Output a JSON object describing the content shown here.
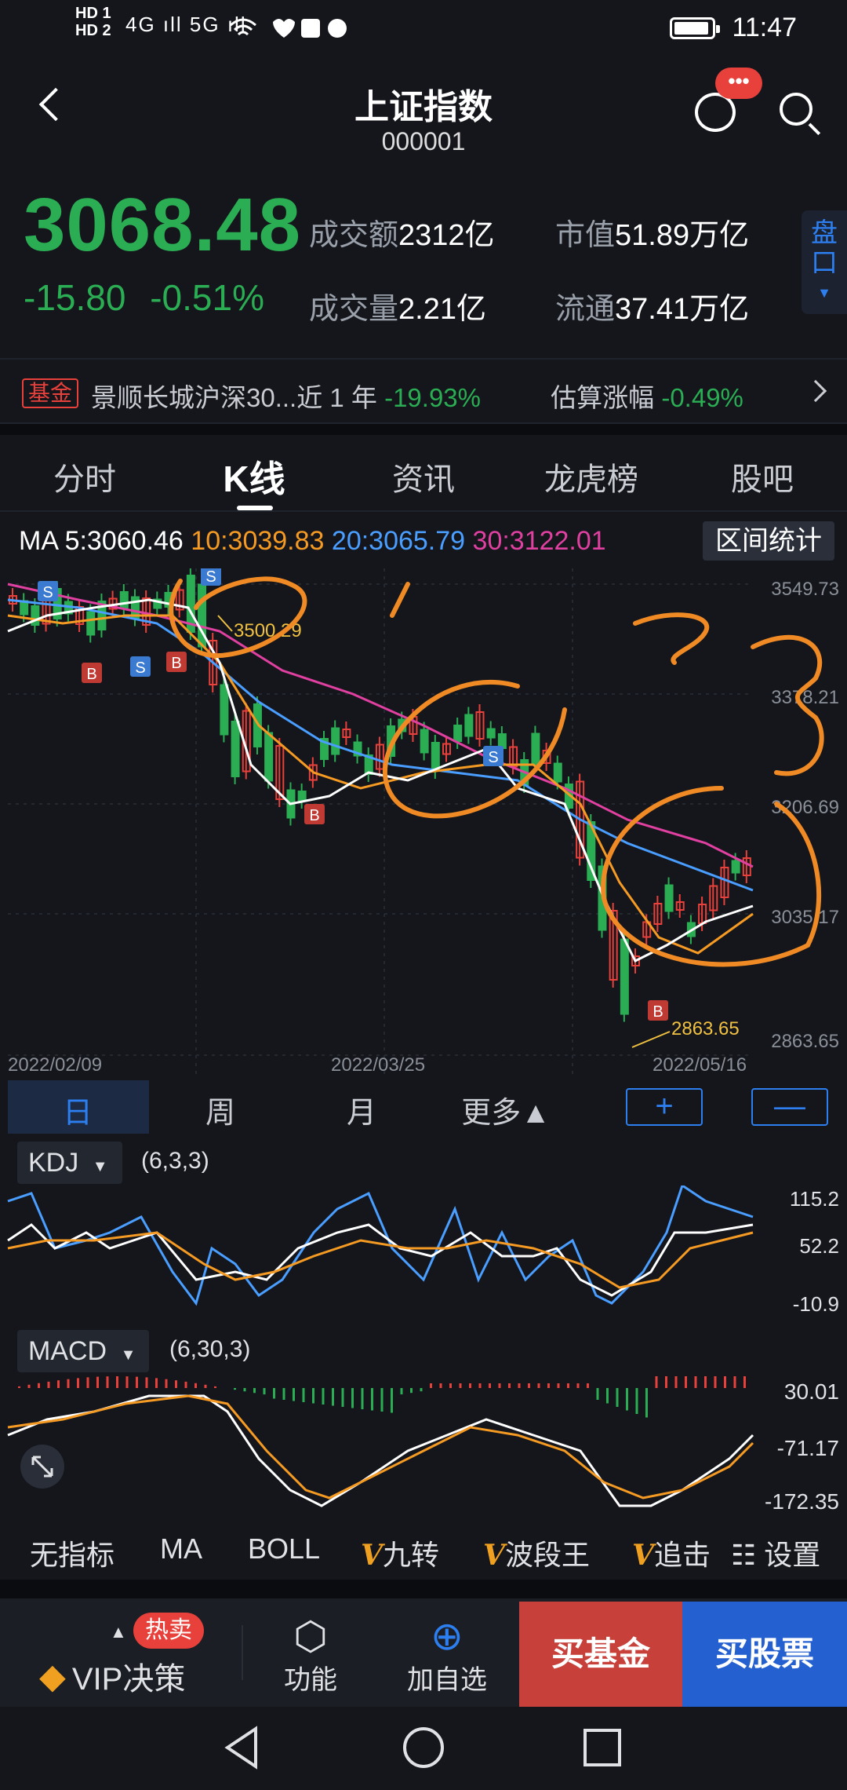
{
  "status_bar": {
    "hd1": "HD 1",
    "hd2": "HD 2",
    "signal": "4G ıll 5G ıll",
    "time": "11:47"
  },
  "header": {
    "title": "上证指数",
    "code": "000001",
    "chat_badge": "•••"
  },
  "quote": {
    "price": "3068.48",
    "change": "-15.80",
    "change_pct": "-0.51%",
    "turnover_label": "成交额",
    "turnover_value": "2312亿",
    "volume_label": "成交量",
    "volume_value": "2.21亿",
    "mktcap_label": "市值",
    "mktcap_value": "51.89万亿",
    "float_label": "流通",
    "float_value": "37.41万亿",
    "pankou": "盘口"
  },
  "fund": {
    "tag": "基金",
    "name": "景顺长城沪深30...近 1 年",
    "year_return": "-19.93%",
    "est_label": "估算涨幅",
    "est_value": "-0.49%"
  },
  "tabs": [
    "分时",
    "K线",
    "资讯",
    "龙虎榜",
    "股吧"
  ],
  "ma": {
    "ma5": "MA 5:3060.46",
    "ma10": "10:3039.83",
    "ma20": "20:3065.79",
    "ma30": "30:3122.01",
    "range_button": "区间统计",
    "color_ma5": "#ffffff",
    "color_ma10": "#f59a23",
    "color_ma20": "#4a9eff",
    "color_ma30": "#e040a0"
  },
  "kline": {
    "y_labels": [
      "3549.73",
      "3378.21",
      "3206.69",
      "3035.17",
      "2863.65"
    ],
    "x_labels": [
      "2022/02/09",
      "2022/03/25",
      "2022/05/16"
    ],
    "high_annot": "3500.29",
    "low_annot": "2863.65",
    "signal_s": "S",
    "signal_b": "B"
  },
  "periods": [
    "日",
    "周",
    "月",
    "更多▲"
  ],
  "zoom": {
    "plus": "+",
    "minus": "—"
  },
  "kdj": {
    "name": "KDJ",
    "params": "(6,3,3)",
    "y_labels": [
      "115.2",
      "52.2",
      "-10.9"
    ]
  },
  "macd": {
    "name": "MACD",
    "params": "(6,30,3)",
    "y_labels": [
      "30.01",
      "-71.17",
      "-172.35"
    ]
  },
  "indicators": {
    "none": "无指标",
    "ma": "MA",
    "boll": "BOLL",
    "v1": "九转",
    "v2": "波段王",
    "v3": "追击",
    "settings": "设置",
    "vmark": "V"
  },
  "actions": {
    "hot": "热卖",
    "vip": "VIP决策",
    "func": "功能",
    "add": "加自选",
    "buy_fund": "买基金",
    "buy_stock": "买股票"
  },
  "colors": {
    "up": "#e8403a",
    "down": "#2aad53",
    "accent": "#2d7ff0",
    "annotation": "#f08a24"
  }
}
